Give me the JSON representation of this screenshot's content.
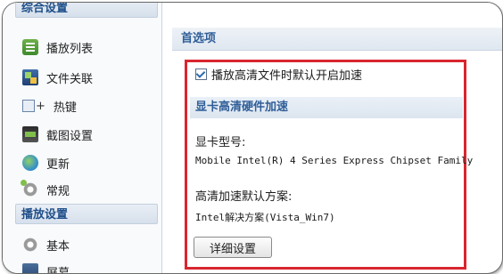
{
  "sidebar": {
    "section1": "综合设置",
    "items1": [
      {
        "label": "播放列表",
        "icon": "playlist-icon"
      },
      {
        "label": "文件关联",
        "icon": "file-association-icon"
      },
      {
        "label": "热键",
        "icon": "hotkey-icon"
      },
      {
        "label": "截图设置",
        "icon": "screenshot-icon"
      },
      {
        "label": "更新",
        "icon": "update-icon"
      },
      {
        "label": "常规",
        "icon": "general-gear-icon"
      }
    ],
    "section2": "播放设置",
    "items2": [
      {
        "label": "基本",
        "icon": "basic-gear-icon"
      },
      {
        "label": "屏幕",
        "icon": "screen-icon"
      }
    ]
  },
  "main": {
    "preferences_title": "首选项",
    "hd_accel_checkbox": {
      "label": "播放高清文件时默认开启加速",
      "checked": true
    },
    "gpu_section_title": "显卡高清硬件加速",
    "gpu_model_label": "显卡型号:",
    "gpu_model_value": "Mobile Intel(R) 4 Series Express Chipset Family",
    "default_scheme_label": "高清加速默认方案:",
    "default_scheme_value": "Intel解决方案(Vista_Win7)",
    "details_button": "详细设置"
  }
}
